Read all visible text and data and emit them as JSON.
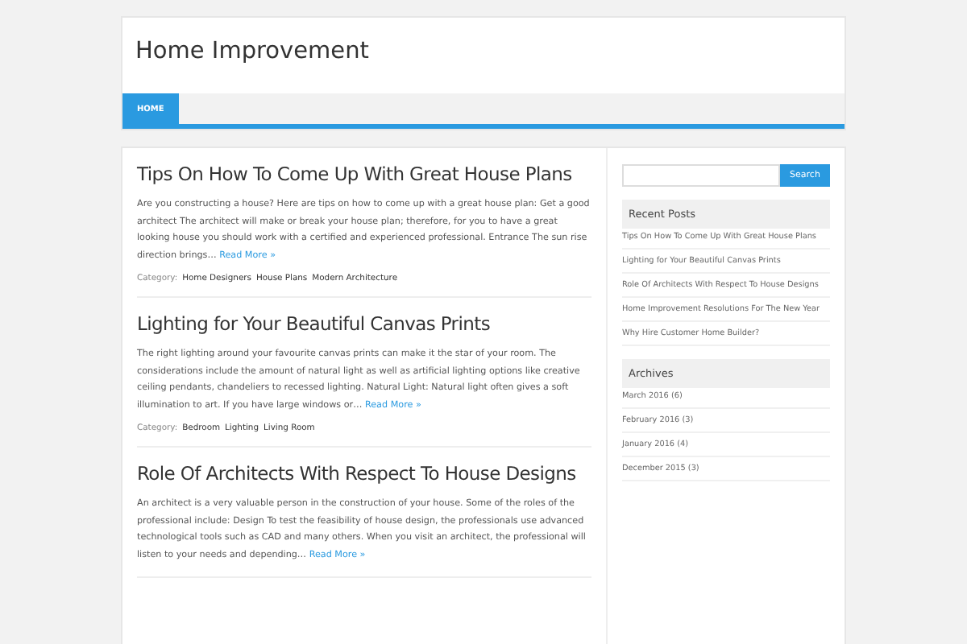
{
  "site": {
    "title": "Home Improvement"
  },
  "nav": [
    {
      "label": "HOME",
      "selected": true
    }
  ],
  "posts": [
    {
      "title": "Tips On How To Come Up With Great House Plans",
      "excerpt": "Are you constructing a house? Here are tips on how to come up with a great house plan: Get a good architect The architect will make or break your house plan; therefore, for you to have a great looking house you should work with a certified and experienced professional. Entrance The sun rise direction brings…",
      "more": "Read More »",
      "category_label": "Category:",
      "categories": [
        "Home Designers",
        "House Plans",
        "Modern Architecture"
      ]
    },
    {
      "title": "Lighting for Your Beautiful Canvas Prints",
      "excerpt": "The right lighting around your favourite canvas prints can make it the star of your room. The considerations include the amount of natural light as well as artificial lighting options like creative ceiling pendants, chandeliers to recessed lighting. Natural Light: Natural light often gives a soft illumination to art. If you have large windows or…",
      "more": "Read More »",
      "category_label": "Category:",
      "categories": [
        "Bedroom",
        "Lighting",
        "Living Room"
      ]
    },
    {
      "title": "Role Of Architects With Respect To House Designs",
      "excerpt": "An architect is a very valuable person in the construction of your house. Some of the roles of the professional include: Design To test the feasibility of house design, the professionals use advanced technological tools such as CAD and many others. When you visit an architect, the professional will listen to your needs and depending…",
      "more": "Read More »"
    }
  ],
  "sidebar": {
    "search": {
      "button": "Search"
    },
    "widgets": [
      {
        "title": "Recent Posts",
        "items": [
          "Tips On How To Come Up With Great House Plans",
          "Lighting for Your Beautiful Canvas Prints",
          "Role Of Architects With Respect To House Designs",
          "Home Improvement Resolutions For The New Year",
          "Why Hire Customer Home Builder?"
        ]
      },
      {
        "title": "Archives",
        "items": [
          "March 2016 (6)",
          "February 2016 (3)",
          "January 2016 (4)",
          "December 2015 (3)"
        ]
      }
    ]
  }
}
